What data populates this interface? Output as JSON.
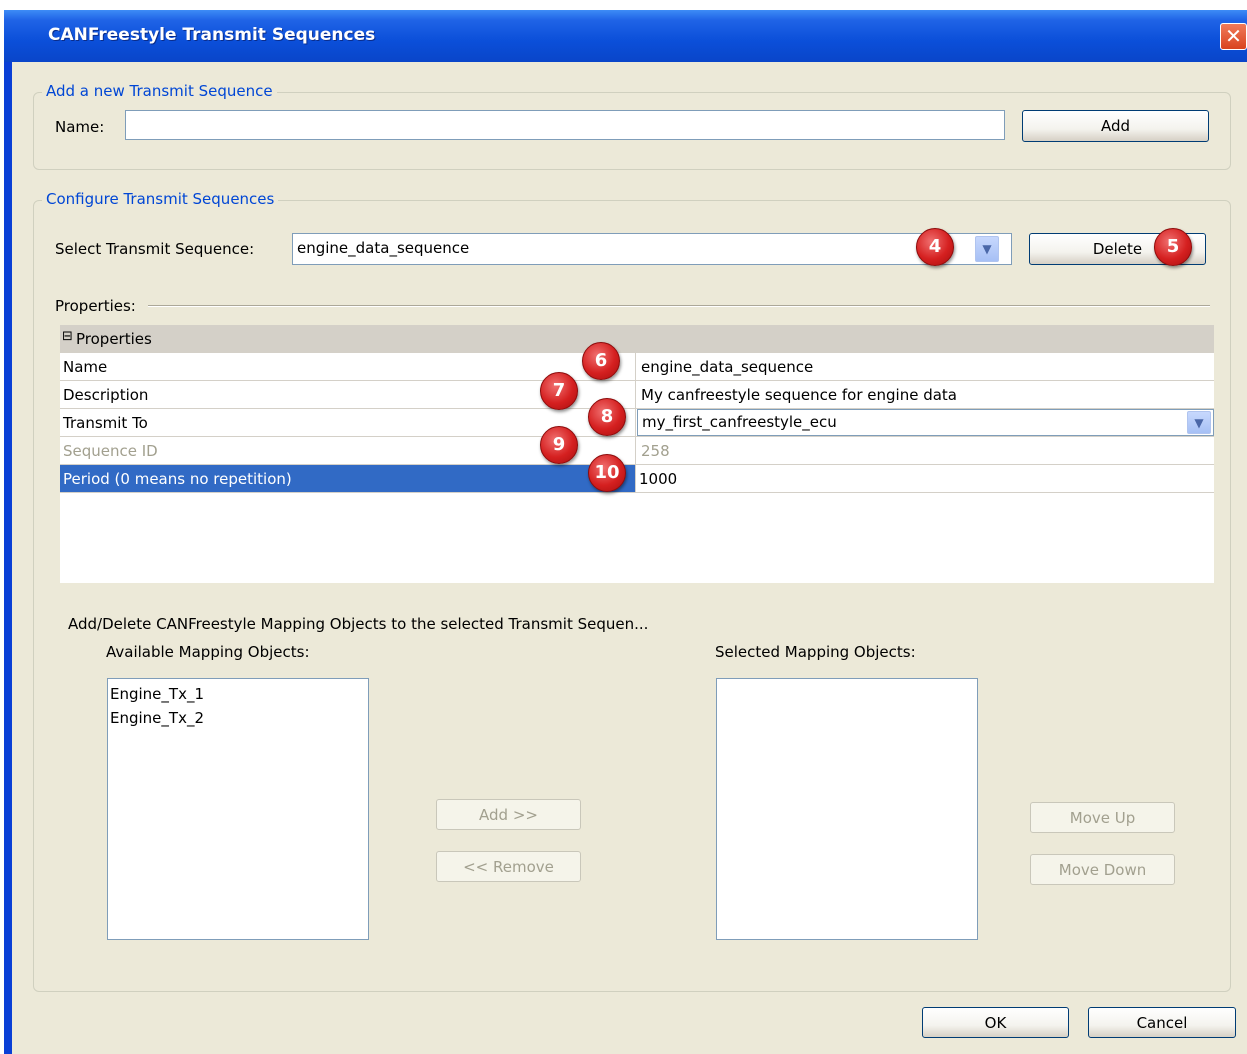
{
  "window": {
    "title": "CANFreestyle Transmit Sequences",
    "close_glyph": "✕"
  },
  "add_group": {
    "title": "Add a new Transmit Sequence",
    "name_label": "Name:",
    "name_value": "",
    "add_button": "Add"
  },
  "configure_group": {
    "title": "Configure Transmit Sequences",
    "select_label": "Select Transmit Sequence:",
    "select_value": "engine_data_sequence",
    "delete_button": "Delete",
    "properties_label": "Properties:"
  },
  "property_grid": {
    "category": "Properties",
    "expand_glyph": "⊟",
    "rows": [
      {
        "name": "Name",
        "value": "engine_data_sequence"
      },
      {
        "name": "Description",
        "value": "My canfreestyle sequence for engine data"
      },
      {
        "name": "Transmit To",
        "value": "my_first_canfreestyle_ecu"
      },
      {
        "name": "Sequence ID",
        "value": "258"
      },
      {
        "name": "Period (0 means no repetition)",
        "value": "1000"
      }
    ]
  },
  "mapping": {
    "heading": "Add/Delete CANFreestyle Mapping Objects to the selected Transmit Sequen...",
    "available_label": "Available Mapping Objects:",
    "available_items": [
      "Engine_Tx_1",
      "Engine_Tx_2"
    ],
    "selected_label": "Selected Mapping Objects:",
    "add_button": "Add >>",
    "remove_button": "<< Remove",
    "move_up_button": "Move Up",
    "move_down_button": "Move Down"
  },
  "markers": [
    "4",
    "5",
    "6",
    "7",
    "8",
    "9",
    "10"
  ],
  "footer": {
    "ok_button": "OK",
    "cancel_button": "Cancel"
  },
  "colors": {
    "title_bar": "#0a4fd9",
    "group_title": "#0046d5",
    "selection": "#316ac5",
    "marker": "#d52020"
  }
}
